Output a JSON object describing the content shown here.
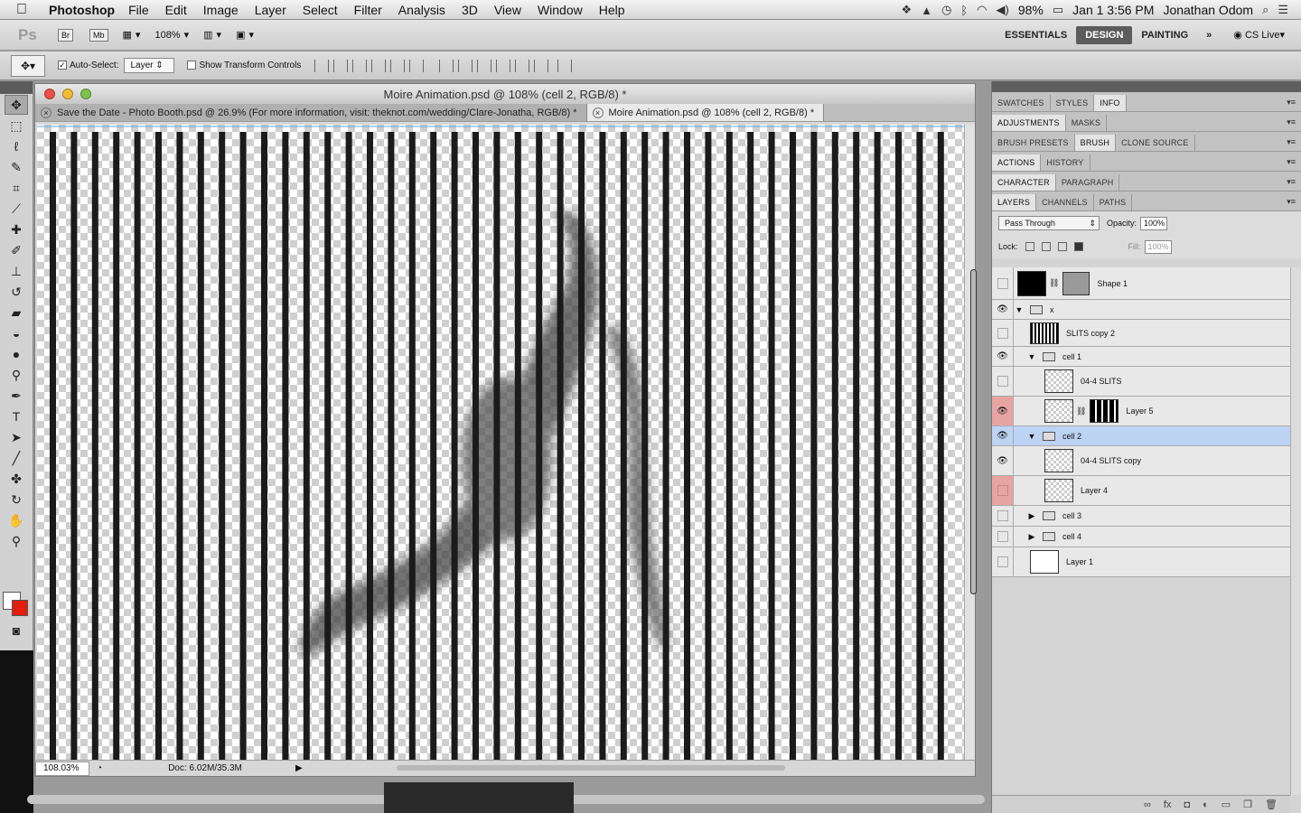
{
  "menubar": {
    "app": "Photoshop",
    "menus": [
      "File",
      "Edit",
      "Image",
      "Layer",
      "Select",
      "Filter",
      "Analysis",
      "3D",
      "View",
      "Window",
      "Help"
    ],
    "battery": "98%",
    "datetime": "Jan 1  3:56 PM",
    "user": "Jonathan Odom"
  },
  "appbar": {
    "logo": "Ps",
    "bridge": "Br",
    "minibridge": "Mb",
    "zoom": "108%",
    "workspaces": [
      "ESSENTIALS",
      "DESIGN",
      "PAINTING"
    ],
    "active_workspace": "DESIGN",
    "more": "»",
    "cslive": "CS Live"
  },
  "options": {
    "auto_select_label": "Auto-Select:",
    "auto_select_checked": true,
    "auto_select_value": "Layer",
    "transform_label": "Show Transform Controls"
  },
  "document": {
    "title": "Moire Animation.psd @ 108% (cell 2, RGB/8) *",
    "tabs": [
      "Save the Date - Photo Booth.psd @ 26.9% (For more information, visit:  theknot.com/wedding/Clare-Jonatha, RGB/8) *",
      "Moire Animation.psd @ 108% (cell 2, RGB/8) *"
    ],
    "status_zoom": "108.03%",
    "status_doc": "Doc: 6.02M/35.3M"
  },
  "panels": {
    "row1": [
      "SWATCHES",
      "STYLES",
      "INFO"
    ],
    "row2": [
      "ADJUSTMENTS",
      "MASKS"
    ],
    "row3": [
      "BRUSH PRESETS",
      "BRUSH",
      "CLONE SOURCE"
    ],
    "row4": [
      "ACTIONS",
      "HISTORY"
    ],
    "row5": [
      "CHARACTER",
      "PARAGRAPH"
    ],
    "row6": [
      "LAYERS",
      "CHANNELS",
      "PATHS"
    ],
    "blend_mode": "Pass Through",
    "opacity_label": "Opacity:",
    "opacity": "100%",
    "lock_label": "Lock:",
    "fill_label": "Fill:",
    "fill": "100%"
  },
  "layers": [
    {
      "name": "Shape 1",
      "visible": false
    },
    {
      "name": "x",
      "visible": true
    },
    {
      "name": "SLITS copy 2",
      "visible": false
    },
    {
      "name": "cell 1",
      "visible": true
    },
    {
      "name": "04-4 SLITS",
      "visible": false
    },
    {
      "name": "Layer 5",
      "visible": true
    },
    {
      "name": "cell 2",
      "visible": true
    },
    {
      "name": "04-4 SLITS copy",
      "visible": true
    },
    {
      "name": "Layer 4",
      "visible": false
    },
    {
      "name": "cell 3",
      "visible": false
    },
    {
      "name": "cell 4",
      "visible": false
    },
    {
      "name": "Layer 1",
      "visible": false
    }
  ],
  "colors": {
    "foreground": "#ffffff",
    "background": "#e31e0f",
    "selected_layer": "#bcd3f3",
    "active_workspace": "#5c5c5c"
  }
}
